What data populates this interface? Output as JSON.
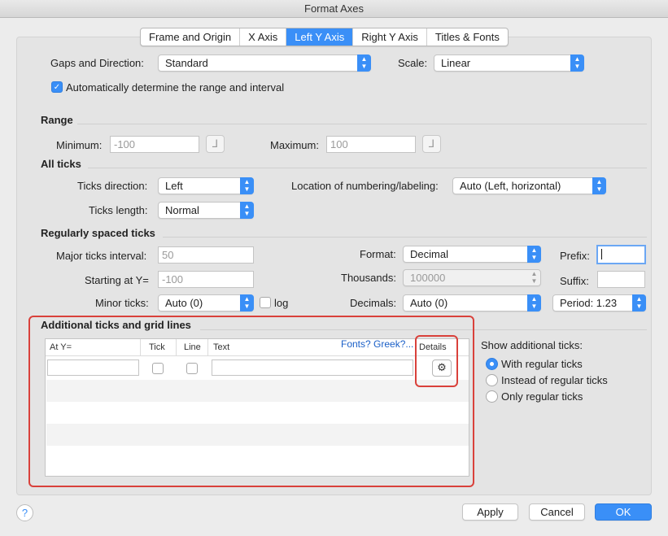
{
  "window": {
    "title": "Format Axes"
  },
  "tabs": [
    {
      "label": "Frame and Origin",
      "active": false
    },
    {
      "label": "X Axis",
      "active": false
    },
    {
      "label": "Left Y Axis",
      "active": true
    },
    {
      "label": "Right Y Axis",
      "active": false
    },
    {
      "label": "Titles & Fonts",
      "active": false
    }
  ],
  "top": {
    "gaps_label": "Gaps and Direction:",
    "gaps_value": "Standard",
    "scale_label": "Scale:",
    "scale_value": "Linear",
    "auto_label": "Automatically determine the range and interval",
    "auto_checked": true
  },
  "range": {
    "title": "Range",
    "min_label": "Minimum:",
    "min_value": "-100",
    "max_label": "Maximum:",
    "max_value": "100"
  },
  "all_ticks": {
    "title": "All ticks",
    "direction_label": "Ticks direction:",
    "direction_value": "Left",
    "location_label": "Location of numbering/labeling:",
    "location_value": "Auto (Left, horizontal)",
    "length_label": "Ticks length:",
    "length_value": "Normal"
  },
  "regular": {
    "title": "Regularly spaced ticks",
    "major_label": "Major ticks interval:",
    "major_value": "50",
    "start_label": "Starting at Y=",
    "start_value": "-100",
    "minor_label": "Minor ticks:",
    "minor_value": "Auto (0)",
    "log_label": "log",
    "format_label": "Format:",
    "format_value": "Decimal",
    "thousands_label": "Thousands:",
    "thousands_value": "100000",
    "decimals_label": "Decimals:",
    "decimals_value": "Auto (0)",
    "prefix_label": "Prefix:",
    "prefix_value": "",
    "suffix_label": "Suffix:",
    "suffix_value": "",
    "period_value": "Period: 1.23"
  },
  "additional": {
    "title": "Additional ticks and grid lines",
    "headers": {
      "at": "At Y=",
      "tick": "Tick",
      "line": "Line",
      "text": "Text",
      "details": "Details"
    },
    "fonts_link": "Fonts? Greek?...",
    "show_label": "Show additional ticks:",
    "options": [
      {
        "label": "With regular ticks",
        "selected": true
      },
      {
        "label": "Instead of regular ticks",
        "selected": false
      },
      {
        "label": "Only regular ticks",
        "selected": false
      }
    ]
  },
  "footer": {
    "help": "?",
    "apply": "Apply",
    "cancel": "Cancel",
    "ok": "OK"
  },
  "colors": {
    "accent": "#3a8ff7",
    "highlight": "#d9413b"
  }
}
